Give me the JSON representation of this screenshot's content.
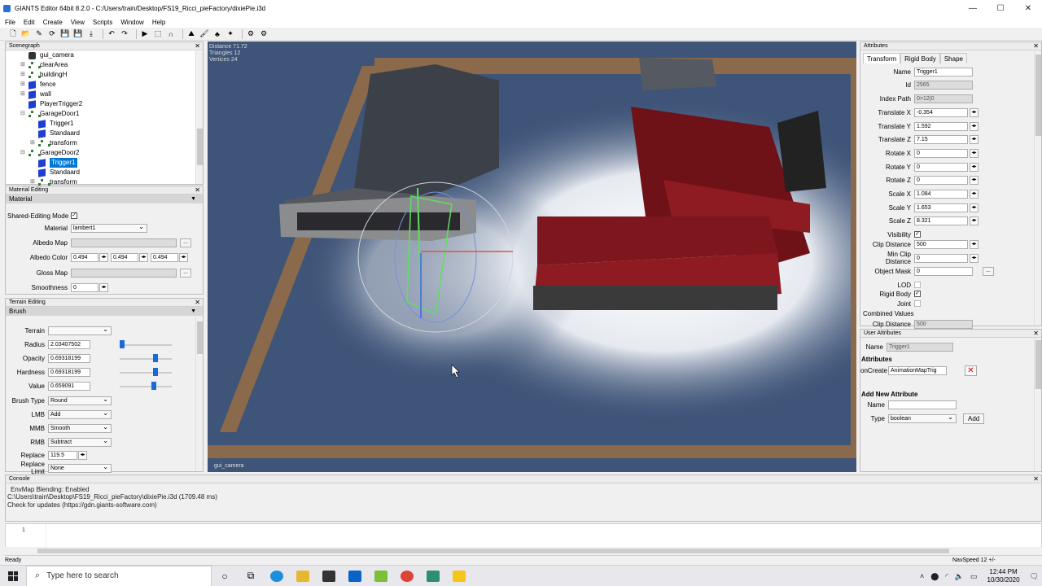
{
  "window": {
    "title": "GIANTS Editor 64bit 8.2.0 - C:/Users/train/Desktop/FS19_Ricci_pieFactory/dixiePie.i3d"
  },
  "menu": [
    "File",
    "Edit",
    "Create",
    "View",
    "Scripts",
    "Window",
    "Help"
  ],
  "scenegraph": {
    "title": "Scenegraph",
    "items": [
      {
        "label": "gui_camera",
        "type": "camera"
      },
      {
        "label": "clearArea",
        "type": "group"
      },
      {
        "label": "buildingH",
        "type": "group"
      },
      {
        "label": "fence",
        "type": "shape"
      },
      {
        "label": "wall",
        "type": "shape"
      },
      {
        "label": "PlayerTrigger2",
        "type": "shape"
      },
      {
        "label": "GarageDoor1",
        "type": "group"
      },
      {
        "label": "Trigger1",
        "type": "shape"
      },
      {
        "label": "Standaard",
        "type": "shape"
      },
      {
        "label": "transform",
        "type": "group"
      },
      {
        "label": "GarageDoor2",
        "type": "group"
      },
      {
        "label": "Trigger1",
        "type": "shape",
        "selected": true
      },
      {
        "label": "Standaard",
        "type": "shape"
      },
      {
        "label": "transform",
        "type": "group"
      }
    ]
  },
  "material_editing": {
    "title": "Material Editing",
    "section": "Material",
    "shared_label": "Shared-Editing Mode",
    "material_label": "Material",
    "material_value": "lambert1",
    "albedo_map_label": "Albedo Map",
    "albedo_color_label": "Albedo Color",
    "albedo_color": [
      "0.494",
      "0.494",
      "0.494"
    ],
    "gloss_map_label": "Gloss Map",
    "smoothness_label": "Smoothness",
    "smoothness_value": "0",
    "dots": "..."
  },
  "terrain_editing": {
    "title": "Terrain Editing",
    "section": "Brush",
    "terrain_label": "Terrain",
    "radius_label": "Radius",
    "radius_value": "2.03407502",
    "radius_level": 0.05,
    "opacity_label": "Opacity",
    "opacity_value": "0.69318199",
    "opacity_level": 0.69,
    "hardness_label": "Hardness",
    "hardness_value": "0.69318199",
    "hardness_level": 0.69,
    "value_label": "Value",
    "value_value": "0.659091",
    "value_level": 0.66,
    "brush_type_label": "Brush Type",
    "brush_type_value": "Round",
    "lmb_label": "LMB",
    "lmb_value": "Add",
    "mmb_label": "MMB",
    "mmb_value": "Smooth",
    "rmb_label": "RMB",
    "rmb_value": "Subtract",
    "replace_label": "Replace",
    "replace_value": "119.5",
    "replace_limit_label": "Replace Limit",
    "replace_limit_value": "None"
  },
  "viewport": {
    "stats": [
      "Distance 71.72",
      "Triangles 12",
      "Vertices 24"
    ],
    "camera": "gui_camera",
    "colors": {
      "ground": "#3e5478",
      "fence": "#8a6a4a",
      "roof_red": "#8e1a22",
      "gizmo": "#5ee05e"
    }
  },
  "attributes": {
    "title": "Attributes",
    "tabs": [
      "Transform",
      "Rigid Body",
      "Shape"
    ],
    "name_label": "Name",
    "name_value": "Trigger1",
    "id_label": "Id",
    "id_value": "2565",
    "index_label": "Index Path",
    "index_value": "0>12|0",
    "tx_label": "Translate X",
    "tx_value": "-0.354",
    "ty_label": "Translate Y",
    "ty_value": "1.592",
    "tz_label": "Translate Z",
    "tz_value": "7.15",
    "rx_label": "Rotate X",
    "rx_value": "0",
    "ry_label": "Rotate Y",
    "ry_value": "0",
    "rz_label": "Rotate Z",
    "rz_value": "0",
    "sx_label": "Scale X",
    "sx_value": "1.084",
    "sy_label": "Scale Y",
    "sy_value": "1.653",
    "sz_label": "Scale Z",
    "sz_value": "8.321",
    "visibility_label": "Visibility",
    "clip_label": "Clip Distance",
    "clip_value": "500",
    "minclip_label": "Min Clip Distance",
    "minclip_value": "0",
    "mask_label": "Object Mask",
    "mask_value": "0",
    "lod_label": "LOD",
    "rigid_label": "Rigid Body",
    "joint_label": "Joint",
    "combined_label": "Combined Values",
    "combined_clip_label": "Clip Distance",
    "combined_clip_value": "500",
    "dots": "..."
  },
  "user_attributes": {
    "title": "User Attributes",
    "name_label": "Name",
    "name_value": "Trigger1",
    "attributes_heading": "Attributes",
    "oncreate_label": "onCreate",
    "oncreate_value": "AnimationMapTrig",
    "add_heading": "Add New Attribute",
    "new_name_label": "Name",
    "type_label": "Type",
    "type_value": "boolean",
    "add_button": "Add"
  },
  "console": {
    "title": "Console",
    "lines": [
      "EnvMap Blending: Enabled",
      "C:\\Users\\train\\Desktop\\FS19_Ricci_pieFactory\\dixiePie.i3d (1709.48 ms)",
      "Check for updates (https://gdn.giants-software.com)"
    ],
    "line_number": "1"
  },
  "status": {
    "left": "Ready",
    "right": "NavSpeed 12 +/-"
  },
  "taskbar": {
    "search_placeholder": "Type here to search",
    "time": "12:44 PM",
    "date": "10/30/2020"
  }
}
